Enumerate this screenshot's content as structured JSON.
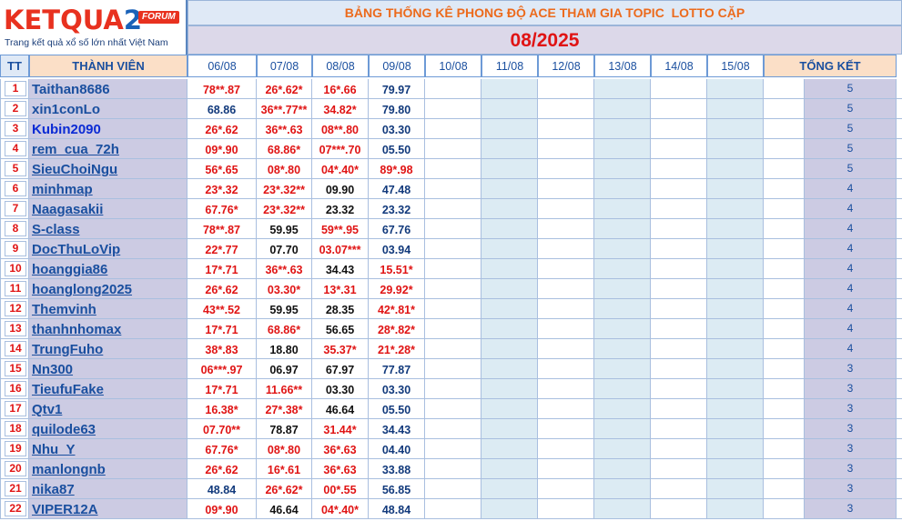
{
  "logo": {
    "brand": "KETQUA",
    "brand_suffix": "2",
    "forum_badge": "FORUM",
    "tagline": "Trang kết quả xổ số lớn nhất Việt Nam"
  },
  "title": "BẢNG THỐNG KÊ PHONG ĐỘ ACE THAM GIA TOPIC  LOTTO CẶP",
  "month": "08/2025",
  "headers": {
    "tt": "TT",
    "member": "THÀNH VIÊN",
    "dates": [
      "06/08",
      "07/08",
      "08/08",
      "09/08",
      "10/08",
      "11/08",
      "12/08",
      "13/08",
      "14/08",
      "15/08"
    ],
    "total": "TỔNG KẾT"
  },
  "colors": {
    "hit": "#e01414",
    "miss": "#111111",
    "link": "#1a4f9f",
    "title_orange": "#ec6a1c",
    "name_bg": "#cccbe3",
    "header_peach": "#fbdfc7"
  },
  "rows": [
    {
      "tt": "1",
      "name": "Taithan8686",
      "vals": [
        "78**.87",
        "26*.62*",
        "16*.66",
        "79.97"
      ],
      "hit": [
        true,
        true,
        true,
        false
      ],
      "total": "5"
    },
    {
      "tt": "2",
      "name": "xin1conLo",
      "vals": [
        "68.86",
        "36**.77**",
        "34.82*",
        "79.80"
      ],
      "hit": [
        false,
        true,
        true,
        false
      ],
      "total": "5"
    },
    {
      "tt": "3",
      "name": "Kubin2090",
      "vals": [
        "26*.62",
        "36**.63",
        "08**.80",
        "03.30"
      ],
      "hit": [
        true,
        true,
        true,
        false
      ],
      "total": "5"
    },
    {
      "tt": "4",
      "name": "rem_cua_72h",
      "vals": [
        "09*.90",
        "68.86*",
        "07***.70",
        "05.50"
      ],
      "hit": [
        true,
        true,
        true,
        false
      ],
      "total": "5"
    },
    {
      "tt": "5",
      "name": "SieuChoiNgu",
      "vals": [
        "56*.65",
        "08*.80",
        "04*.40*",
        "89*.98"
      ],
      "hit": [
        true,
        true,
        true,
        true
      ],
      "total": "5"
    },
    {
      "tt": "6",
      "name": "minhmap",
      "vals": [
        "23*.32",
        "23*.32**",
        "09.90",
        "47.48"
      ],
      "hit": [
        true,
        true,
        false,
        false
      ],
      "total": "4"
    },
    {
      "tt": "7",
      "name": "Naagasakii",
      "vals": [
        "67.76*",
        "23*.32**",
        "23.32",
        "23.32"
      ],
      "hit": [
        true,
        true,
        false,
        false
      ],
      "total": "4"
    },
    {
      "tt": "8",
      "name": "S-class",
      "vals": [
        "78**.87",
        "59.95",
        "59**.95",
        "67.76"
      ],
      "hit": [
        true,
        false,
        true,
        false
      ],
      "total": "4"
    },
    {
      "tt": "9",
      "name": "DocThuLoVip",
      "vals": [
        "22*.77",
        "07.70",
        "03.07***",
        "03.94"
      ],
      "hit": [
        true,
        false,
        true,
        false
      ],
      "total": "4"
    },
    {
      "tt": "10",
      "name": "hoanggia86",
      "vals": [
        "17*.71",
        "36**.63",
        "34.43",
        "15.51*"
      ],
      "hit": [
        true,
        true,
        false,
        true
      ],
      "total": "4"
    },
    {
      "tt": "11",
      "name": "hoanglong2025",
      "vals": [
        "26*.62",
        "03.30*",
        "13*.31",
        "29.92*"
      ],
      "hit": [
        true,
        true,
        true,
        true
      ],
      "total": "4"
    },
    {
      "tt": "12",
      "name": "Themvinh",
      "vals": [
        "43**.52",
        "59.95",
        "28.35",
        "42*.81*"
      ],
      "hit": [
        true,
        false,
        false,
        true
      ],
      "total": "4"
    },
    {
      "tt": "13",
      "name": "thanhnhomax",
      "vals": [
        "17*.71",
        "68.86*",
        "56.65",
        "28*.82*"
      ],
      "hit": [
        true,
        true,
        false,
        true
      ],
      "total": "4"
    },
    {
      "tt": "14",
      "name": "TrungFuho",
      "vals": [
        "38*.83",
        "18.80",
        "35.37*",
        "21*.28*"
      ],
      "hit": [
        true,
        false,
        true,
        true
      ],
      "total": "4"
    },
    {
      "tt": "15",
      "name": "Nn300",
      "vals": [
        "06***.97",
        "06.97",
        "67.97",
        "77.87"
      ],
      "hit": [
        true,
        false,
        false,
        false
      ],
      "total": "3"
    },
    {
      "tt": "16",
      "name": "TieufuFake",
      "vals": [
        "17*.71",
        "11.66**",
        "03.30",
        "03.30"
      ],
      "hit": [
        true,
        true,
        false,
        false
      ],
      "total": "3"
    },
    {
      "tt": "17",
      "name": "Qtv1",
      "vals": [
        "16.38*",
        "27*.38*",
        "46.64",
        "05.50"
      ],
      "hit": [
        true,
        true,
        false,
        false
      ],
      "total": "3"
    },
    {
      "tt": "18",
      "name": "quilode63",
      "vals": [
        "07.70**",
        "78.87",
        "31.44*",
        "34.43"
      ],
      "hit": [
        true,
        false,
        true,
        false
      ],
      "total": "3"
    },
    {
      "tt": "19",
      "name": "Nhu_Y",
      "vals": [
        "67.76*",
        "08*.80",
        "36*.63",
        "04.40"
      ],
      "hit": [
        true,
        true,
        true,
        false
      ],
      "total": "3"
    },
    {
      "tt": "20",
      "name": "manlongnb",
      "vals": [
        "26*.62",
        "16*.61",
        "36*.63",
        "33.88"
      ],
      "hit": [
        true,
        true,
        true,
        false
      ],
      "total": "3"
    },
    {
      "tt": "21",
      "name": "nika87",
      "vals": [
        "48.84",
        "26*.62*",
        "00*.55",
        "56.85"
      ],
      "hit": [
        false,
        true,
        true,
        false
      ],
      "total": "3"
    },
    {
      "tt": "22",
      "name": "VIPER12A",
      "vals": [
        "09*.90",
        "46.64",
        "04*.40*",
        "48.84"
      ],
      "hit": [
        true,
        false,
        true,
        false
      ],
      "total": "3"
    }
  ]
}
